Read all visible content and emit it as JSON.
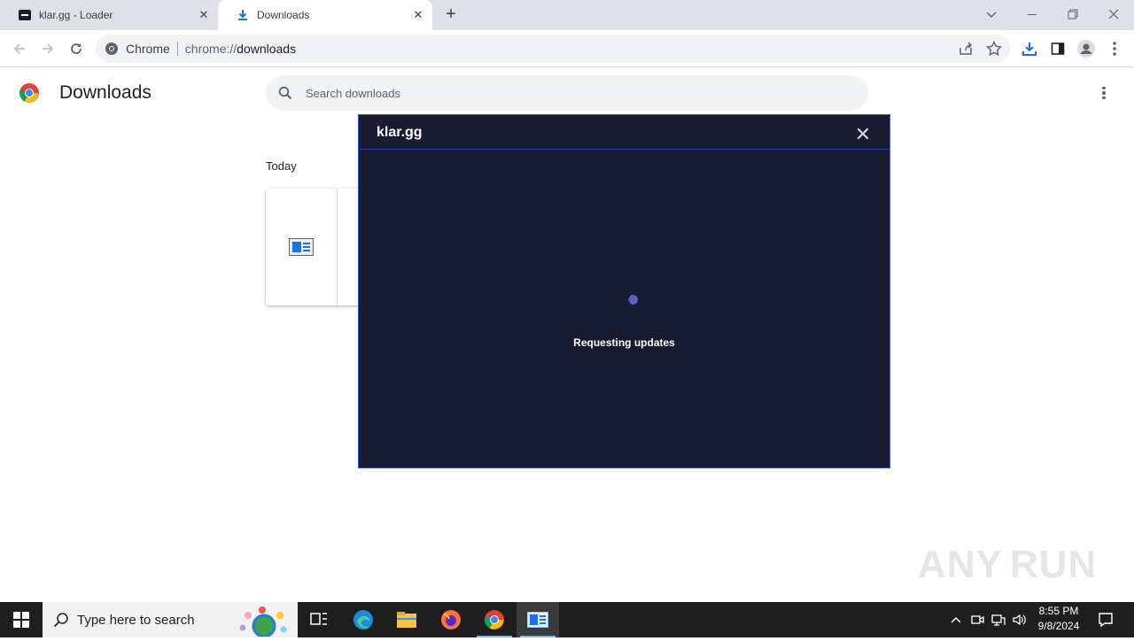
{
  "browser": {
    "tabs": [
      {
        "title": "klar.gg - Loader",
        "active": false
      },
      {
        "title": "Downloads",
        "active": true
      }
    ],
    "omnibox": {
      "chip": "Chrome",
      "url_scheme": "chrome://",
      "url_host": "downloads"
    }
  },
  "page": {
    "title": "Downloads",
    "search_placeholder": "Search downloads",
    "section_label": "Today"
  },
  "dialog": {
    "title": "klar.gg",
    "status": "Requesting updates",
    "accent": "#3a4cc0",
    "background": "#191c31"
  },
  "watermark": {
    "left": "ANY",
    "right": "RUN"
  },
  "taskbar": {
    "search_placeholder": "Type here to search",
    "time": "8:55 PM",
    "date": "9/8/2024"
  }
}
